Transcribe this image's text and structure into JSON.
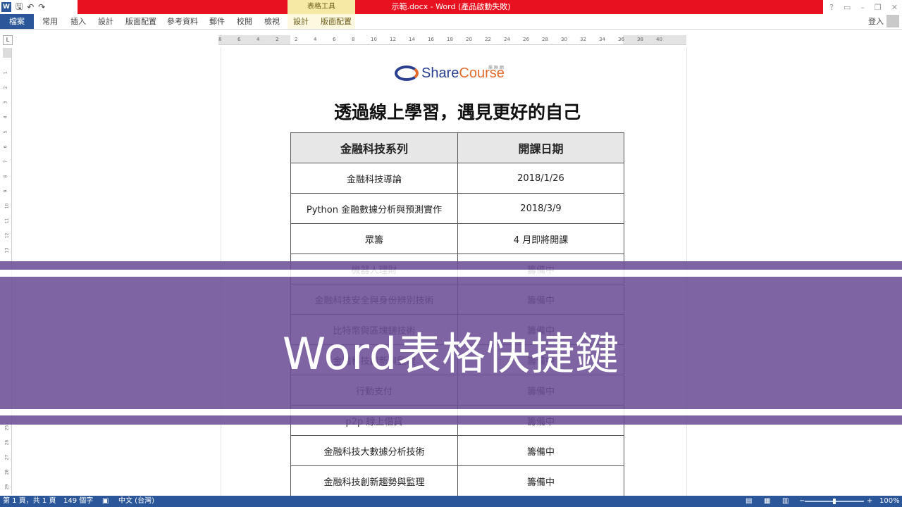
{
  "window": {
    "title": "示範.docx - Word (產品啟動失敗)",
    "context_group": "表格工具",
    "app_icon": "W"
  },
  "ribbon": {
    "file_tab": "檔案",
    "tabs": [
      "常用",
      "插入",
      "設計",
      "版面配置",
      "參考資料",
      "郵件",
      "校閱",
      "檢視"
    ],
    "context_tabs": [
      "設計",
      "版面配置"
    ],
    "signin": "登入"
  },
  "ruler": {
    "corner": "L",
    "h_numbers": [
      "8",
      "6",
      "4",
      "2",
      "2",
      "4",
      "6",
      "8",
      "10",
      "12",
      "14",
      "16",
      "18",
      "20",
      "22",
      "24",
      "26",
      "28",
      "30",
      "32",
      "34",
      "36",
      "38",
      "40"
    ],
    "v_numbers": [
      "1",
      "2",
      "3",
      "4",
      "5",
      "6",
      "7",
      "8",
      "9",
      "10",
      "11",
      "12",
      "13",
      "25",
      "26",
      "27",
      "28",
      "29"
    ]
  },
  "document": {
    "logo_text_a": "Share",
    "logo_text_b": "Course",
    "logo_small": "學 聯 網",
    "heading": "透過線上學習，遇見更好的自己",
    "table_headers": [
      "金融科技系列",
      "開課日期"
    ],
    "rows": [
      [
        "金融科技導論",
        "2018/1/26"
      ],
      [
        "Python 金融數據分析與預測實作",
        "2018/3/9"
      ],
      [
        "眾籌",
        "4 月即將開課"
      ],
      [
        "機器人理財",
        "籌備中"
      ],
      [
        "金融科技安全與身份辨別技術",
        "籌備中"
      ],
      [
        "比特幣與區塊鏈技術",
        "籌備中"
      ],
      [
        "金融科技創新與監理",
        "籌備中"
      ],
      [
        "行動支付",
        "籌備中"
      ],
      [
        "p2p 線上借貸",
        "籌備中"
      ],
      [
        "金融科技大數據分析技術",
        "籌備中"
      ],
      [
        "金融科技創新趨勢與監理",
        "籌備中"
      ]
    ]
  },
  "overlay": {
    "title": "Word表格快捷鍵",
    "band_color": "#6c4e96"
  },
  "status": {
    "page": "第 1 頁，共 1 頁",
    "words": "149 個字",
    "language": "中文 (台灣)",
    "zoom": "100%",
    "zoom_value": 1.0
  },
  "colors": {
    "titlebar_red": "#e8111f",
    "word_blue": "#2b579a",
    "context_tab": "#f6e9a5"
  }
}
